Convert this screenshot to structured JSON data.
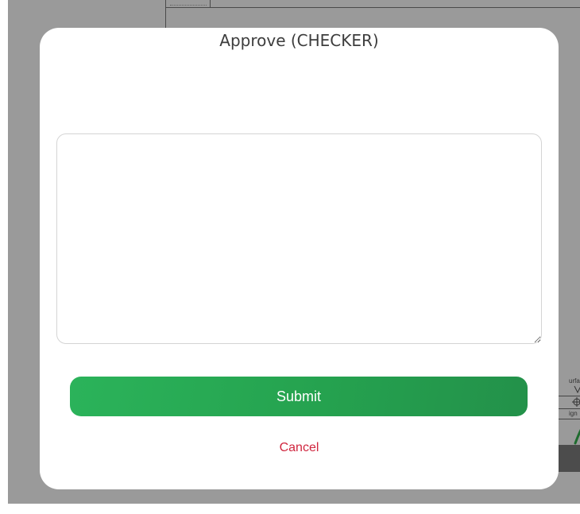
{
  "background_drawing": {
    "title_block_labels": [
      "urface",
      "ign"
    ]
  },
  "dialog": {
    "title": "Approve (CHECKER)",
    "comment_value": "",
    "comment_placeholder": "",
    "submit_label": "Submit",
    "cancel_label": "Cancel"
  },
  "colors": {
    "overlay": "#9a9a9a",
    "dialog_bg": "#ffffff",
    "submit_green": "#25a24f",
    "cancel_red": "#d0253e",
    "title_text": "#3d3d3d"
  }
}
